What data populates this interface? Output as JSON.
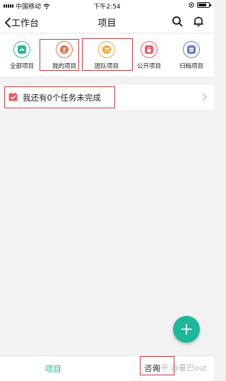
{
  "status_bar": {
    "carrier": "中国移动",
    "time": "下午2:54",
    "battery_level": 0.75
  },
  "nav": {
    "back_label": "工作台",
    "title": "项目",
    "icons": [
      "search-icon",
      "bell-icon"
    ]
  },
  "quick_actions": [
    {
      "label": "全部项目",
      "icon": "dashboard-icon",
      "color": "#2fb59a"
    },
    {
      "label": "我的项目",
      "icon": "person-icon",
      "color": "#e6704e"
    },
    {
      "label": "团队项目",
      "icon": "team-icon",
      "color": "#f0a73a"
    },
    {
      "label": "公开项目",
      "icon": "unlock-icon",
      "color": "#e85a6a"
    },
    {
      "label": "归档项目",
      "icon": "archive-icon",
      "color": "#6a7bd6"
    }
  ],
  "task_banner": {
    "text": "我还有0个任务未完成",
    "icon": "calendar-check-icon",
    "color": "#e85a6a"
  },
  "fab": {
    "icon": "plus-icon",
    "color": "#1db89a"
  },
  "tab_bar": {
    "tabs": [
      {
        "label": "项目",
        "active": true
      },
      {
        "label": "咨询"
      }
    ]
  },
  "watermark": "知乎 @曼巴out",
  "colors": {
    "accent": "#1db89a",
    "highlight_box": "#c23d3d"
  }
}
